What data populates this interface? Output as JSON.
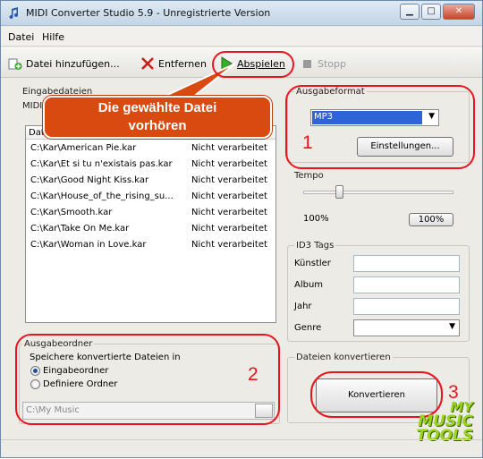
{
  "titlebar": {
    "title": "MIDI Converter Studio 5.9 -  Unregistrierte Version"
  },
  "menu": {
    "items": [
      "Datei",
      "Hilfe"
    ]
  },
  "toolbar": {
    "add_label": "Datei hinzufügen...",
    "remove_label": "Entfernen",
    "play_label": "Abspielen",
    "stop_label": "Stopp"
  },
  "callout": {
    "line1": "Die gewählte Datei",
    "line2": "vorhören"
  },
  "input_files": {
    "group_label": "Eingabedateien",
    "subtitle_prefix": "MIDI",
    "header_prefix": "Dat",
    "rows": [
      {
        "file": "C:\\Kar\\American Pie.kar",
        "status": "Nicht verarbeitet"
      },
      {
        "file": "C:\\Kar\\Et si tu n'existais pas.kar",
        "status": "Nicht verarbeitet"
      },
      {
        "file": "C:\\Kar\\Good Night Kiss.kar",
        "status": "Nicht verarbeitet"
      },
      {
        "file": "C:\\Kar\\House_of_the_rising_su...",
        "status": "Nicht verarbeitet"
      },
      {
        "file": "C:\\Kar\\Smooth.kar",
        "status": "Nicht verarbeitet"
      },
      {
        "file": "C:\\Kar\\Take On Me.kar",
        "status": "Nicht verarbeitet"
      },
      {
        "file": "C:\\Kar\\Woman in Love.kar",
        "status": "Nicht verarbeitet"
      }
    ]
  },
  "output_format": {
    "group_label": "Ausgabeformat",
    "selected": "MP3",
    "settings_button": "Einstellungen..."
  },
  "tempo": {
    "group_label": "Tempo",
    "value_text": "100%",
    "button": "100%",
    "slider_value": 0.32
  },
  "id3": {
    "group_label": "ID3 Tags",
    "fields": [
      "Künstler",
      "Album",
      "Jahr",
      "Genre"
    ]
  },
  "output_folder": {
    "group_label": "Ausgabeordner",
    "caption": "Speichere konvertierte Dateien in",
    "option1": "Eingabeordner",
    "option2": "Definiere Ordner",
    "path_placeholder": "C:\\My Music"
  },
  "convert": {
    "group_label": "Dateien konvertieren",
    "button": "Konvertieren"
  },
  "markers": [
    "1",
    "2",
    "3"
  ],
  "watermark": {
    "line1": "MY",
    "line2": "MUSIC",
    "line3": "TOOLS"
  },
  "colors": {
    "accent": "#d94a10",
    "marker": "#e8141e",
    "selection": "#2f64d8"
  }
}
